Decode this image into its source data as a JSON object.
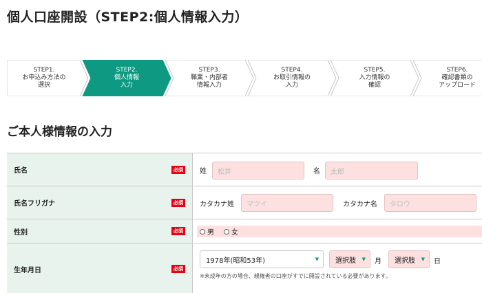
{
  "page_title": "個人口座開設（STEP2:個人情報入力）",
  "steps": [
    {
      "label": "STEP1.\nお申込み方法の\n選択",
      "active": false
    },
    {
      "label": "STEP2.\n個人情報\n入力",
      "active": true
    },
    {
      "label": "STEP3.\n職業・内部者\n情報入力",
      "active": false
    },
    {
      "label": "STEP4.\nお取引情報の\n入力",
      "active": false
    },
    {
      "label": "STEP5.\n入力情報の\n確認",
      "active": false
    },
    {
      "label": "STEP6.\n確認書類の\nアップロード",
      "active": false
    }
  ],
  "colors": {
    "accent": "#0e9a82",
    "required": "#e60012",
    "field_bg": "#fde0e0",
    "label_bg": "#e9f3ee"
  },
  "section_title": "ご本人様情報の入力",
  "required_badge": "必須",
  "rows": {
    "name": {
      "label": "氏名",
      "last_label": "姓",
      "last_placeholder": "松井",
      "first_label": "名",
      "first_placeholder": "太郎"
    },
    "kana": {
      "label": "氏名フリガナ",
      "last_label": "カタカナ姓",
      "last_placeholder": "マツイ",
      "first_label": "カタカナ名",
      "first_placeholder": "タロウ"
    },
    "gender": {
      "label": "性別",
      "male": "男",
      "female": "女"
    },
    "birthdate": {
      "label": "生年月日",
      "year_value": "1978年(昭和53年)",
      "month_value": "選択肢",
      "month_unit": "月",
      "day_value": "選択肢",
      "day_unit": "日",
      "note": "※未成年の方の場合、親権者の口座がすでに開設されている必要があります。"
    }
  }
}
